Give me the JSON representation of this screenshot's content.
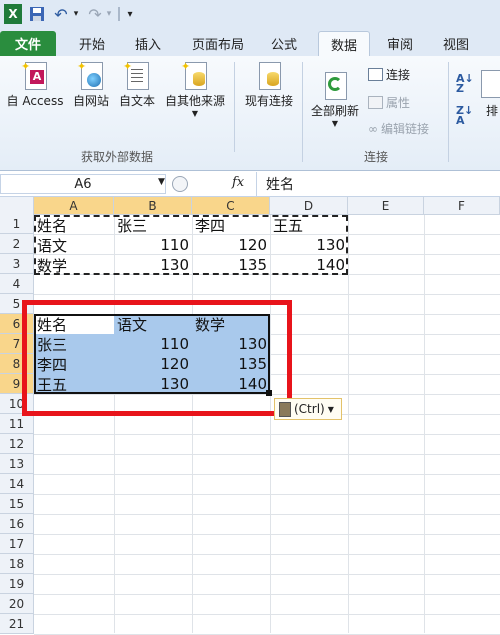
{
  "qat": {
    "app_icon": "X",
    "save_icon": "save-icon",
    "undo_icon": "undo-icon",
    "redo_icon": "redo-icon"
  },
  "tabs": [
    "文件",
    "开始",
    "插入",
    "页面布局",
    "公式",
    "数据",
    "审阅",
    "视图"
  ],
  "ribbon": {
    "group_external": {
      "label": "获取外部数据",
      "buttons": [
        "自 Access",
        "自网站",
        "自文本",
        "自其他来源",
        "现有连接"
      ]
    },
    "group_connections": {
      "label": "连接",
      "refresh_all": "全部刷新",
      "items": [
        "连接",
        "属性",
        "编辑链接"
      ]
    },
    "sort_label": "排"
  },
  "formula_bar": {
    "name_box": "A6",
    "fx": "fx",
    "content": "姓名"
  },
  "columns": [
    "A",
    "B",
    "C",
    "D",
    "E",
    "F"
  ],
  "rows": [
    "1",
    "2",
    "3",
    "4",
    "5",
    "6",
    "7",
    "8",
    "9",
    "10",
    "11",
    "12",
    "13",
    "14",
    "15",
    "16",
    "17",
    "18",
    "19",
    "20",
    "21"
  ],
  "table1": [
    [
      "姓名",
      "张三",
      "李四",
      "王五"
    ],
    [
      "语文",
      "110",
      "120",
      "130"
    ],
    [
      "数学",
      "130",
      "135",
      "140"
    ]
  ],
  "table2": [
    [
      "姓名",
      "语文",
      "数学"
    ],
    [
      "张三",
      "110",
      "130"
    ],
    [
      "李四",
      "120",
      "135"
    ],
    [
      "王五",
      "130",
      "140"
    ]
  ],
  "paste_options": {
    "label": "(Ctrl)"
  },
  "colors": {
    "highlight": "#a9c9ec",
    "red_box": "#e8141b",
    "header_selected": "#f9d68b",
    "file_tab": "#2a8d3e"
  }
}
